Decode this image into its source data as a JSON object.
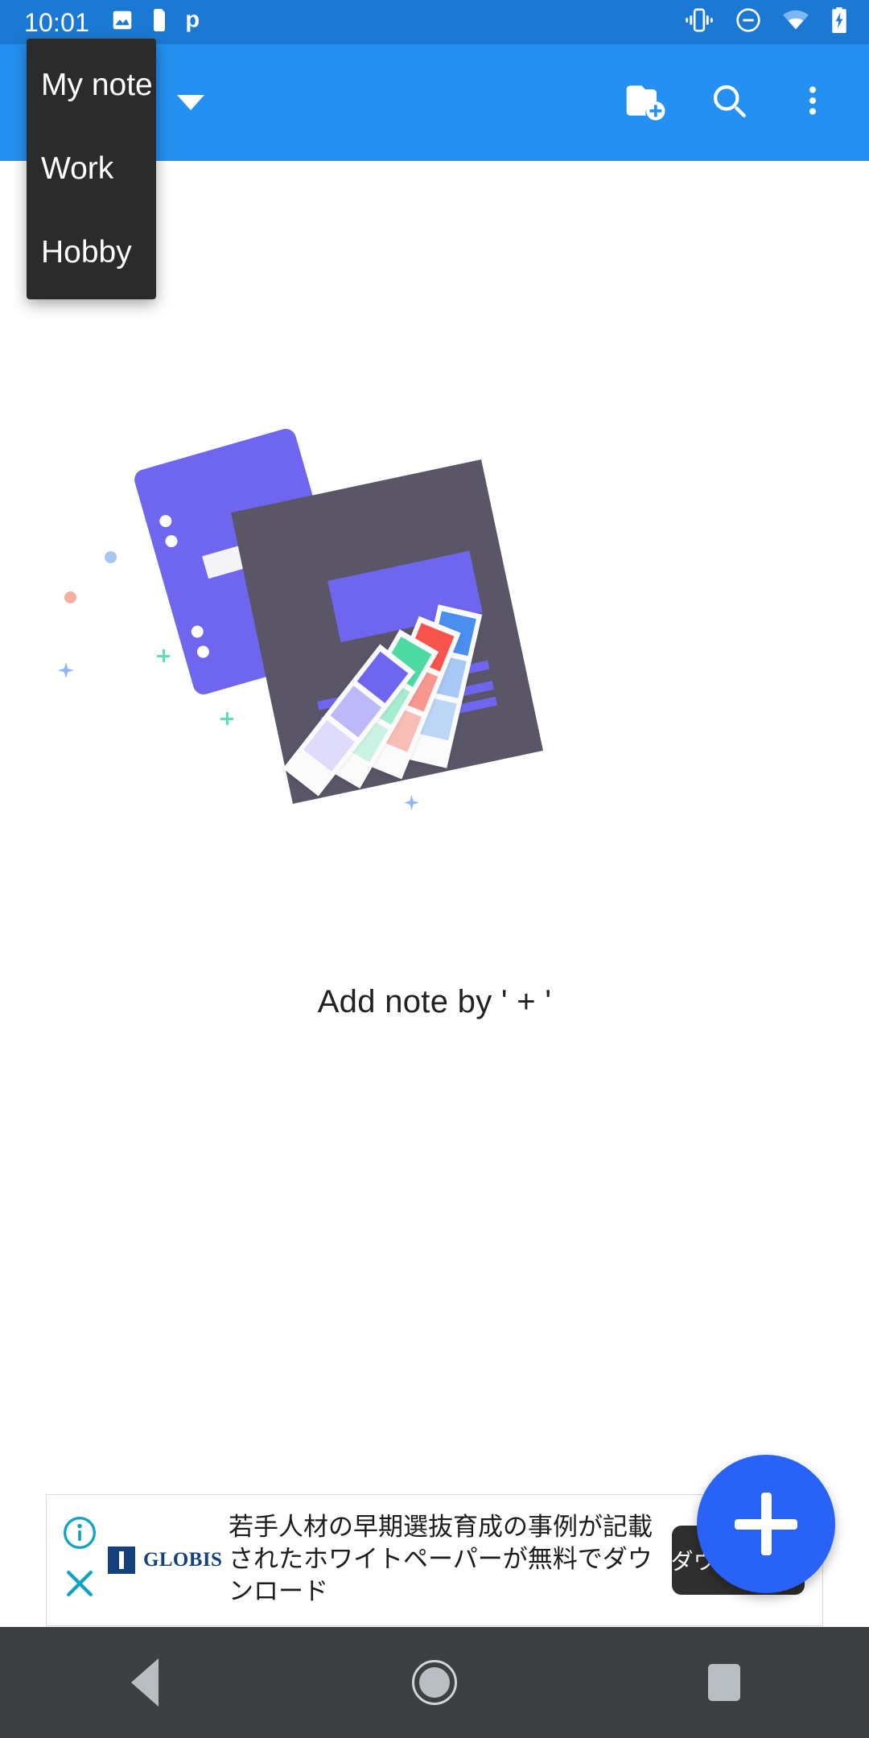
{
  "status_bar": {
    "clock": "10:01",
    "left_icons": [
      "image-icon",
      "sim-card-icon",
      "p-app-icon"
    ],
    "right_icons": [
      "vibrate-icon",
      "do-not-disturb-icon",
      "wifi-icon",
      "battery-charging-icon"
    ],
    "background": "#1b79d3"
  },
  "app_bar": {
    "title": "My note",
    "background": "#2491f2",
    "actions": [
      {
        "name": "create-new-folder-icon",
        "label": "Create new folder"
      },
      {
        "name": "search-icon",
        "label": "Search"
      },
      {
        "name": "overflow-menu-icon",
        "label": "More options"
      }
    ]
  },
  "dropdown": {
    "visible": true,
    "background": "#2b2b2b",
    "items": [
      {
        "label": "My note",
        "selected": true
      },
      {
        "label": "Work",
        "selected": false
      },
      {
        "label": "Hobby",
        "selected": false
      }
    ]
  },
  "empty_state": {
    "message": "Add note by ' + '",
    "illustration": {
      "name": "notes-and-swatches-illustration",
      "colors": {
        "paper_purple": "#6f66f0",
        "sheet_dark": "#5a5668",
        "swatch_purple": "#6f66f0",
        "swatch_green": "#3fd6a0",
        "swatch_red": "#f9534d",
        "swatch_blue": "#4a8ef0"
      }
    }
  },
  "fab": {
    "label": "+",
    "icon": "plus-icon",
    "color": "#2962f6"
  },
  "ad": {
    "info_icon": "info-icon",
    "close_icon": "close-icon",
    "advertiser": "GLOBIS",
    "copy": "若手人材の早期選抜育成の事例が記載されたホワイトペーパーが無料でダウンロード",
    "cta_label": "ダウンロード",
    "accent": "#0fa3c4"
  },
  "nav_bar": {
    "background": "#3c4043",
    "buttons": [
      {
        "name": "nav-back-button",
        "label": "Back"
      },
      {
        "name": "nav-home-button",
        "label": "Home"
      },
      {
        "name": "nav-recents-button",
        "label": "Recents"
      }
    ]
  }
}
